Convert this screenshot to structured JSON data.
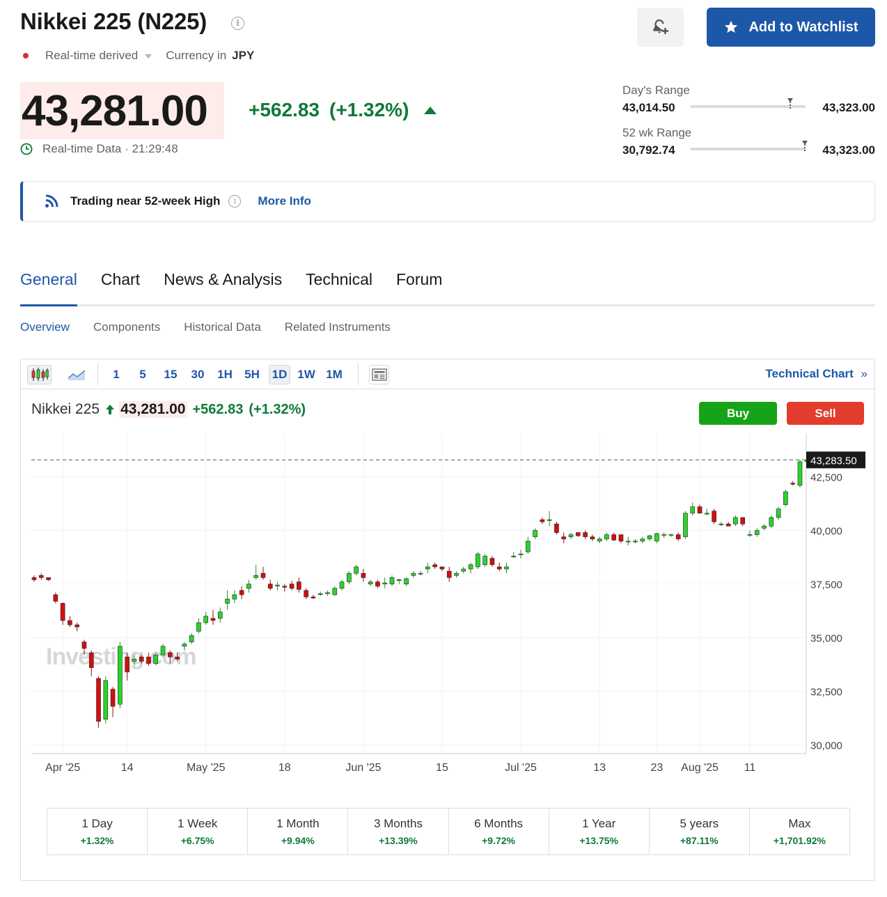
{
  "header": {
    "title": "Nikkei 225 (N225)",
    "info_icon": "info-icon",
    "meta": {
      "source": "Real-time derived",
      "currency_label": "Currency in",
      "currency": "JPY"
    },
    "bell_icon": "bell-plus-icon",
    "watchlist_label": "Add to Watchlist"
  },
  "quote": {
    "price": "43,281.00",
    "change": "+562.83",
    "change_pct": "(+1.32%)",
    "realtime_label": "Real-time Data · 21:29:48"
  },
  "ranges": {
    "day": {
      "label": "Day's Range",
      "low": "43,014.50",
      "high": "43,323.00",
      "position": 0.87
    },
    "week52": {
      "label": "52 wk Range",
      "low": "30,792.74",
      "high": "43,323.00",
      "position": 0.996
    }
  },
  "banner": {
    "text": "Trading near 52-week High",
    "more": "More Info"
  },
  "tabs": [
    "General",
    "Chart",
    "News & Analysis",
    "Technical",
    "Forum"
  ],
  "subtabs": [
    "Overview",
    "Components",
    "Historical Data",
    "Related Instruments"
  ],
  "toolbar": {
    "intervals": [
      "1",
      "5",
      "15",
      "30",
      "1H",
      "5H",
      "1D",
      "1W",
      "1M"
    ],
    "selected_interval": "1D",
    "technical_chart": "Technical Chart",
    "technical_chevron": "»"
  },
  "chart_header": {
    "name": "Nikkei 225",
    "price": "43,281.00",
    "change": "+562.83",
    "change_pct": "(+1.32%)",
    "buy": "Buy",
    "sell": "Sell"
  },
  "chart_data": {
    "type": "candlestick",
    "y_ticks": [
      "42,500",
      "40,000",
      "37,500",
      "35,000",
      "32,500",
      "30,000"
    ],
    "y_tick_values": [
      42500,
      40000,
      37500,
      35000,
      32500,
      30000
    ],
    "ylim": [
      29600,
      44400
    ],
    "x_ticks": [
      "Apr '25",
      "14",
      "May '25",
      "18",
      "Jun '25",
      "15",
      "Jul '25",
      "13",
      "23",
      "Aug '25",
      "11"
    ],
    "x_tick_index": [
      4,
      13,
      24,
      35,
      46,
      57,
      68,
      79,
      87,
      93,
      100
    ],
    "last_price_label": "43,283.50",
    "last_price": 43283.5,
    "watermark": "Investing.com",
    "candles": [
      [
        37800,
        37900,
        37600,
        37700
      ],
      [
        37900,
        38000,
        37700,
        37800
      ],
      [
        37800,
        37800,
        37650,
        37700
      ],
      [
        37000,
        37100,
        36600,
        36700
      ],
      [
        36600,
        36650,
        35600,
        35800
      ],
      [
        35800,
        36000,
        35500,
        35600
      ],
      [
        35600,
        35700,
        35300,
        35500
      ],
      [
        34800,
        34900,
        34200,
        34500
      ],
      [
        34300,
        34400,
        33200,
        33600
      ],
      [
        33100,
        33200,
        30800,
        31100
      ],
      [
        31200,
        33200,
        31000,
        33000
      ],
      [
        32600,
        32700,
        31300,
        31800
      ],
      [
        31900,
        34800,
        31700,
        34600
      ],
      [
        34100,
        34300,
        33000,
        33400
      ],
      [
        33900,
        34200,
        33700,
        34000
      ],
      [
        34100,
        34200,
        33800,
        33900
      ],
      [
        34100,
        34300,
        33700,
        33800
      ],
      [
        33800,
        34300,
        33700,
        34200
      ],
      [
        34200,
        34700,
        34100,
        34600
      ],
      [
        34300,
        34400,
        33800,
        34100
      ],
      [
        34100,
        34300,
        33900,
        34000
      ],
      [
        34600,
        34800,
        34400,
        34700
      ],
      [
        34800,
        35200,
        34700,
        35100
      ],
      [
        35300,
        35900,
        35200,
        35700
      ],
      [
        35700,
        36200,
        35600,
        36000
      ],
      [
        35900,
        36300,
        35600,
        35800
      ],
      [
        35900,
        36400,
        35700,
        36200
      ],
      [
        36600,
        37200,
        36300,
        36800
      ],
      [
        36800,
        37200,
        36600,
        37000
      ],
      [
        37200,
        37400,
        36800,
        37000
      ],
      [
        37300,
        37700,
        37100,
        37500
      ],
      [
        37800,
        38400,
        37700,
        37900
      ],
      [
        38000,
        38300,
        37700,
        37800
      ],
      [
        37500,
        37700,
        37200,
        37300
      ],
      [
        37450,
        37600,
        37200,
        37450
      ],
      [
        37400,
        37500,
        37150,
        37350
      ],
      [
        37500,
        37650,
        37200,
        37300
      ],
      [
        37600,
        37800,
        37100,
        37250
      ],
      [
        37200,
        37300,
        36800,
        36900
      ],
      [
        36900,
        37000,
        36800,
        36850
      ],
      [
        37050,
        37150,
        36950,
        37050
      ],
      [
        37050,
        37200,
        36950,
        37100
      ],
      [
        37000,
        37400,
        36950,
        37300
      ],
      [
        37300,
        37700,
        37200,
        37600
      ],
      [
        37600,
        38100,
        37500,
        38000
      ],
      [
        38000,
        38400,
        37900,
        38300
      ],
      [
        38000,
        38200,
        37600,
        37800
      ],
      [
        37500,
        37700,
        37400,
        37600
      ],
      [
        37600,
        37700,
        37300,
        37400
      ],
      [
        37500,
        37800,
        37300,
        37550
      ],
      [
        37500,
        37900,
        37400,
        37800
      ],
      [
        37700,
        37750,
        37500,
        37700
      ],
      [
        37500,
        37800,
        37400,
        37750
      ],
      [
        37900,
        38100,
        37800,
        38000
      ],
      [
        38000,
        38100,
        37900,
        38000
      ],
      [
        38200,
        38500,
        38000,
        38300
      ],
      [
        38400,
        38500,
        38200,
        38300
      ],
      [
        38300,
        38300,
        38100,
        38200
      ],
      [
        38100,
        38300,
        37600,
        37800
      ],
      [
        37900,
        38100,
        37800,
        38000
      ],
      [
        38100,
        38300,
        38000,
        38200
      ],
      [
        38200,
        38500,
        38000,
        38400
      ],
      [
        38300,
        39000,
        38200,
        38900
      ],
      [
        38400,
        38900,
        38300,
        38800
      ],
      [
        38700,
        38800,
        38300,
        38400
      ],
      [
        38300,
        38500,
        38100,
        38200
      ],
      [
        38200,
        38500,
        38000,
        38300
      ],
      [
        38800,
        39000,
        38700,
        38800
      ],
      [
        38900,
        39100,
        38700,
        38900
      ],
      [
        39000,
        39700,
        38900,
        39500
      ],
      [
        39700,
        40100,
        39600,
        40000
      ],
      [
        40500,
        40600,
        40300,
        40400
      ],
      [
        40500,
        40900,
        40200,
        40500
      ],
      [
        40300,
        40400,
        39800,
        39900
      ],
      [
        39700,
        39900,
        39400,
        39600
      ],
      [
        39700,
        39900,
        39600,
        39800
      ],
      [
        39900,
        39900,
        39700,
        39750
      ],
      [
        39900,
        40000,
        39600,
        39700
      ],
      [
        39700,
        39800,
        39500,
        39600
      ],
      [
        39500,
        39700,
        39400,
        39600
      ],
      [
        39600,
        39900,
        39500,
        39800
      ],
      [
        39800,
        39900,
        39500,
        39550
      ],
      [
        39800,
        39800,
        39400,
        39500
      ],
      [
        39500,
        39700,
        39300,
        39500
      ],
      [
        39500,
        39600,
        39400,
        39500
      ],
      [
        39500,
        39700,
        39400,
        39600
      ],
      [
        39600,
        39800,
        39500,
        39750
      ],
      [
        39500,
        39900,
        39400,
        39850
      ],
      [
        39800,
        39900,
        39650,
        39800
      ],
      [
        39800,
        39850,
        39700,
        39800
      ],
      [
        39800,
        39900,
        39500,
        39600
      ],
      [
        39700,
        40900,
        39600,
        40800
      ],
      [
        40800,
        41300,
        40700,
        41100
      ],
      [
        41100,
        41200,
        40800,
        40800
      ],
      [
        40800,
        41000,
        40700,
        40800
      ],
      [
        40900,
        41000,
        40300,
        40400
      ],
      [
        40300,
        40400,
        40200,
        40300
      ],
      [
        40300,
        40400,
        40200,
        40200
      ],
      [
        40300,
        40700,
        40200,
        40600
      ],
      [
        40600,
        40600,
        40200,
        40300
      ],
      [
        39800,
        40000,
        39700,
        39800
      ],
      [
        39800,
        40100,
        39700,
        40000
      ],
      [
        40100,
        40300,
        40000,
        40200
      ],
      [
        40200,
        40700,
        40100,
        40600
      ],
      [
        40600,
        41100,
        40500,
        41000
      ],
      [
        41200,
        41900,
        41100,
        41800
      ],
      [
        42200,
        42300,
        42100,
        42150
      ],
      [
        42100,
        43300,
        42000,
        43200
      ],
      [
        43200,
        43323,
        43100,
        43280
      ]
    ]
  },
  "performance": [
    {
      "label": "1 Day",
      "value": "+1.32%"
    },
    {
      "label": "1 Week",
      "value": "+6.75%"
    },
    {
      "label": "1 Month",
      "value": "+9.94%"
    },
    {
      "label": "3 Months",
      "value": "+13.39%"
    },
    {
      "label": "6 Months",
      "value": "+9.72%"
    },
    {
      "label": "1 Year",
      "value": "+13.75%"
    },
    {
      "label": "5 years",
      "value": "+87.11%"
    },
    {
      "label": "Max",
      "value": "+1,701.92%"
    }
  ],
  "colors": {
    "up": "#2bd42b",
    "down": "#d40e0e",
    "accent": "#1d57a8",
    "positive_text": "#0e7a38"
  }
}
